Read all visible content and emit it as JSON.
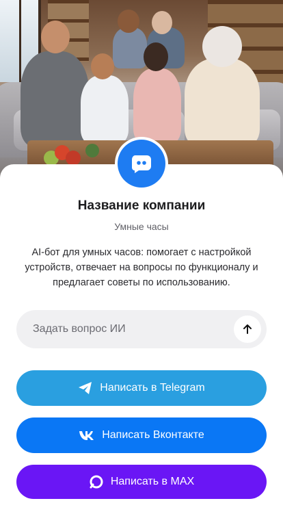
{
  "company": {
    "name": "Название компании",
    "subtitle": "Умные часы",
    "description": "AI-бот для умных часов: помогает с настройкой устройств, отвечает на вопросы по функционалу и предлагает советы по использованию.",
    "avatar_icon": "chat-bot-icon"
  },
  "ask": {
    "placeholder": "Задать вопрос ИИ",
    "send_icon": "arrow-up-icon"
  },
  "buttons": [
    {
      "label": "Написать в Telegram",
      "icon": "telegram-icon",
      "color": "#2a9fe0"
    },
    {
      "label": "Написать Вконтакте",
      "icon": "vk-icon",
      "color": "#0a77f5"
    },
    {
      "label": "Написать в MAX",
      "icon": "max-icon",
      "color": "#6a16f5"
    }
  ],
  "colors": {
    "avatar": "#1e7cf2",
    "input_bg": "#f0f0f2"
  }
}
